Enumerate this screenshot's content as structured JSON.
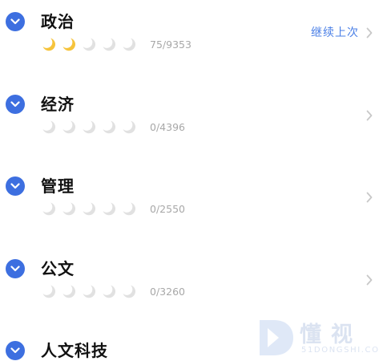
{
  "colors": {
    "accent": "#3d6fe0",
    "moon_filled": "#f6c43c",
    "moon_empty": "#e1e1e1",
    "count_text": "#a8a8a8",
    "continue_text": "#4a7fe6"
  },
  "subjects": [
    {
      "title": "政治",
      "progress_moons_filled": 2,
      "progress_moons_total": 5,
      "count": "75/9353",
      "action": "继续上次"
    },
    {
      "title": "经济",
      "progress_moons_filled": 0,
      "progress_moons_total": 5,
      "count": "0/4396"
    },
    {
      "title": "管理",
      "progress_moons_filled": 0,
      "progress_moons_total": 5,
      "count": "0/2550"
    },
    {
      "title": "公文",
      "progress_moons_filled": 0,
      "progress_moons_total": 5,
      "count": "0/3260"
    },
    {
      "title": "人文科技"
    }
  ],
  "icons": {
    "expand": "chevron-down-icon",
    "row_arrow": "chevron-right-icon",
    "moon": "crescent-moon-icon"
  },
  "watermark": {
    "text": "懂视",
    "domain": "51DONGSHI.COM"
  }
}
